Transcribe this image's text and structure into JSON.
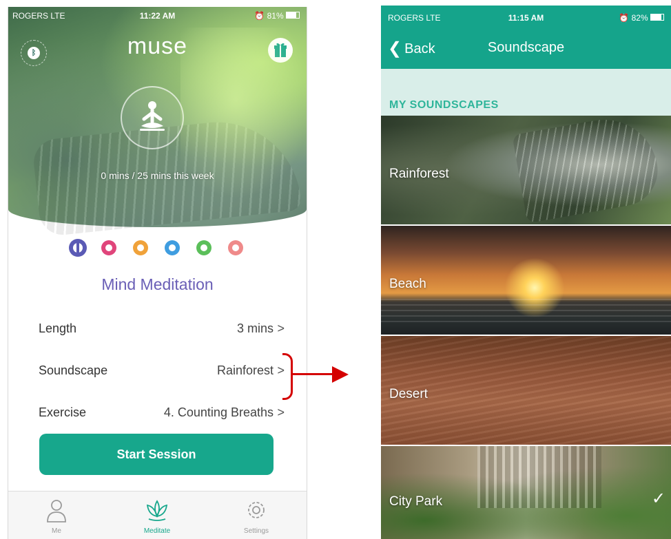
{
  "left": {
    "status": {
      "carrier": "ROGERS  LTE",
      "time": "11:22 AM",
      "battery": "81%"
    },
    "logo": "muse",
    "week_progress": "0 mins / 25 mins this week",
    "mode_title": "Mind Meditation",
    "mode_icons": [
      {
        "name": "mind-icon",
        "color": "#5a5ab5"
      },
      {
        "name": "heart-icon",
        "color": "#e0457b"
      },
      {
        "name": "body-icon",
        "color": "#f0a23a"
      },
      {
        "name": "breath-icon",
        "color": "#3f9de0"
      },
      {
        "name": "leaf-icon",
        "color": "#5bbf5a"
      },
      {
        "name": "timer-icon",
        "color": "#ef8a8a"
      }
    ],
    "settings": [
      {
        "label": "Length",
        "value": "3 mins"
      },
      {
        "label": "Soundscape",
        "value": "Rainforest"
      },
      {
        "label": "Exercise",
        "value": "4. Counting Breaths"
      }
    ],
    "start_button": "Start Session",
    "tabs": [
      {
        "label": "Me",
        "icon": "person-icon",
        "active": false
      },
      {
        "label": "Meditate",
        "icon": "lotus-icon",
        "active": true
      },
      {
        "label": "Settings",
        "icon": "gear-icon",
        "active": false
      }
    ],
    "colors": {
      "accent": "#17a78c",
      "title": "#6a5fb6"
    }
  },
  "right": {
    "status": {
      "carrier": "ROGERS  LTE",
      "time": "11:15 AM",
      "battery": "82%"
    },
    "back_label": "Back",
    "title": "Soundscape",
    "section_header": "MY SOUNDSCAPES",
    "soundscapes": [
      {
        "name": "Rainforest",
        "selected": false
      },
      {
        "name": "Beach",
        "selected": false
      },
      {
        "name": "Desert",
        "selected": false
      },
      {
        "name": "City Park",
        "selected": true
      }
    ],
    "colors": {
      "header": "#15a48b",
      "section": "#2fb59a"
    }
  }
}
